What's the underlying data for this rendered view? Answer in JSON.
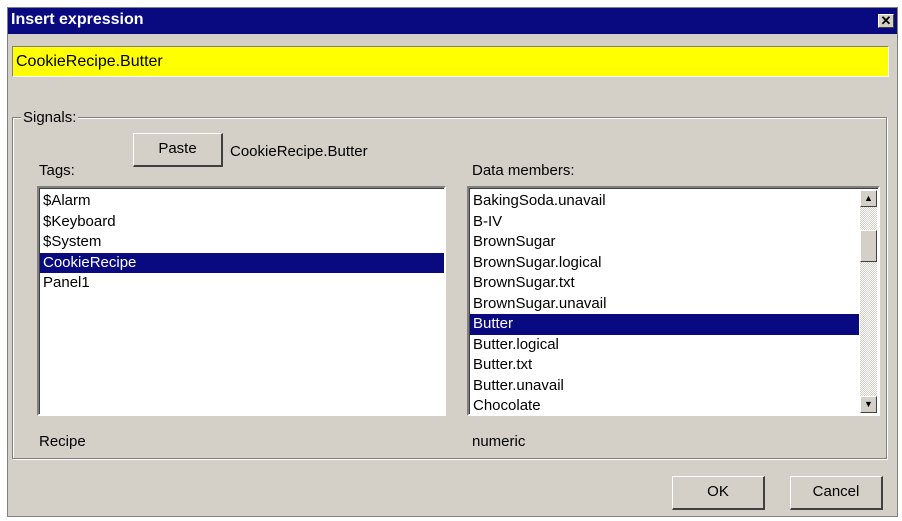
{
  "window": {
    "title": "Insert expression",
    "close_icon": "close-icon"
  },
  "expression": {
    "value": "CookieRecipe.Butter",
    "background": "#ffff00"
  },
  "signals": {
    "legend": "Signals:",
    "paste_label": "Paste",
    "current_signal": "CookieRecipe.Butter",
    "tags_label": "Tags:",
    "members_label": "Data members:",
    "tags": [
      {
        "label": "$Alarm",
        "selected": false
      },
      {
        "label": "$Keyboard",
        "selected": false
      },
      {
        "label": "$System",
        "selected": false
      },
      {
        "label": "CookieRecipe",
        "selected": true
      },
      {
        "label": "Panel1",
        "selected": false
      }
    ],
    "members": [
      {
        "label": "BakingSoda.unavail",
        "selected": false
      },
      {
        "label": "B-IV",
        "selected": false
      },
      {
        "label": "BrownSugar",
        "selected": false
      },
      {
        "label": "BrownSugar.logical",
        "selected": false
      },
      {
        "label": "BrownSugar.txt",
        "selected": false
      },
      {
        "label": "BrownSugar.unavail",
        "selected": false
      },
      {
        "label": "Butter",
        "selected": true
      },
      {
        "label": "Butter.logical",
        "selected": false
      },
      {
        "label": "Butter.txt",
        "selected": false
      },
      {
        "label": "Butter.unavail",
        "selected": false
      },
      {
        "label": "Chocolate",
        "selected": false
      }
    ],
    "tag_type": "Recipe",
    "member_type": "numeric"
  },
  "buttons": {
    "ok": "OK",
    "cancel": "Cancel"
  },
  "colors": {
    "titlebar": "#0a0a80",
    "selection": "#0a0a80",
    "face": "#d4d0c8"
  }
}
